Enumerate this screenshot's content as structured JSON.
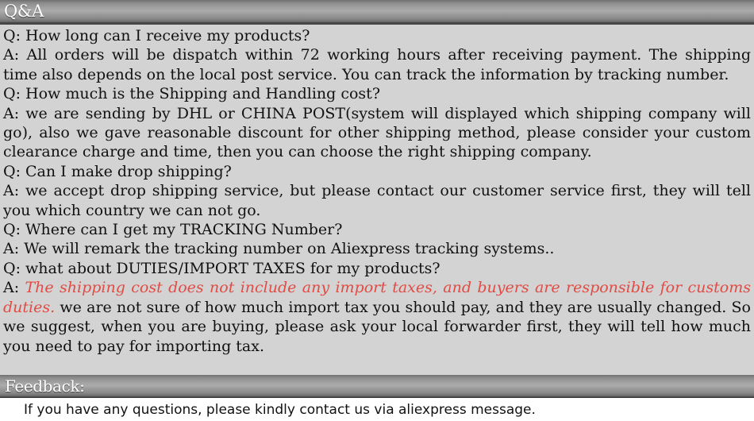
{
  "qa_section": {
    "title": "Q&A",
    "background_color": "#d3d3d3",
    "bar_gradient_top": "#6f6f6f",
    "bar_gradient_mid": "#ababab",
    "bar_gradient_bottom": "#3d3d3d",
    "accent_red": "#e24b44",
    "entries": [
      {
        "question_prefix": "Q:",
        "question": " How long can I receive my products?",
        "answer_prefix": "A:",
        "answer": " All orders will be dispatch within 72 working hours after receiving payment. The shipping time also depends on the local post service. You can track the information by tracking number."
      },
      {
        "question_prefix": "Q:",
        "question": " How much is the Shipping and Handling cost?",
        "answer_prefix": "A:",
        "answer": " we are sending by DHL or CHINA POST(system will displayed which shipping company will go), also we gave reasonable discount for other shipping method, please consider your custom clearance charge and time, then you can choose the right shipping company."
      },
      {
        "question_prefix": "Q:",
        "question": " Can I make drop shipping?",
        "answer_prefix": "A:",
        "answer": " we accept drop shipping service, but please contact our customer service first, they will tell you which country we can not go."
      },
      {
        "question_prefix": "Q:",
        "question": " Where can I get my TRACKING Number?",
        "answer_prefix": "A:",
        "answer": " We will remark the tracking number on Aliexpress tracking systems.."
      },
      {
        "question_prefix": "Q:",
        "question": " what about DUTIES/IMPORT TAXES for my products?",
        "answer_prefix": "A:",
        "answer_highlight": " The shipping cost does not include any import taxes, and buyers are responsible for customs duties.",
        "answer": " we are not sure of how much import tax you should pay, and they are usually changed. So we suggest, when you are buying, please ask your local forwarder first, they will tell how much you need to pay for importing tax."
      }
    ]
  },
  "feedback_section": {
    "title": "Feedback:",
    "body_text": "If you have any questions, please kindly contact us via aliexpress message.",
    "background_color": "#ffffff"
  }
}
